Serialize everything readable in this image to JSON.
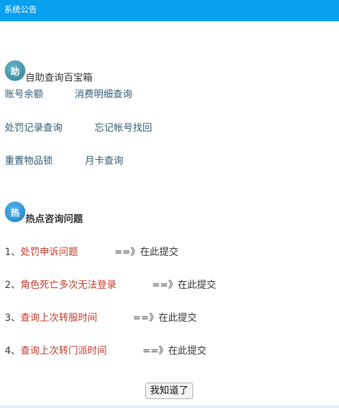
{
  "header": {
    "title": "系统公告",
    "bg_color": "#0aa0f0"
  },
  "self_help": {
    "icon_text": "助",
    "title": "自助查询百宝箱",
    "links": [
      "账号余额",
      "消费明细查询",
      "处罚记录查询",
      "忘记帐号找回",
      "重置物品锁",
      "月卡查询"
    ]
  },
  "hot_questions": {
    "icon_text": "热",
    "title": "热点咨询问题",
    "items": [
      {
        "number": "1、",
        "text": "处罚申诉问题",
        "submit": "==》在此提交"
      },
      {
        "number": "2、",
        "text": "角色死亡多次无法登录",
        "submit": "==》在此提交"
      },
      {
        "number": "3、",
        "text": "查询上次转服时间",
        "submit": "==》在此提交"
      },
      {
        "number": "4、",
        "text": "查询上次转门派时间",
        "submit": "==》在此提交"
      }
    ]
  },
  "ok_button": {
    "label": "我知道了"
  },
  "colors": {
    "link": "#2f5b73",
    "question": "#c0392b"
  }
}
